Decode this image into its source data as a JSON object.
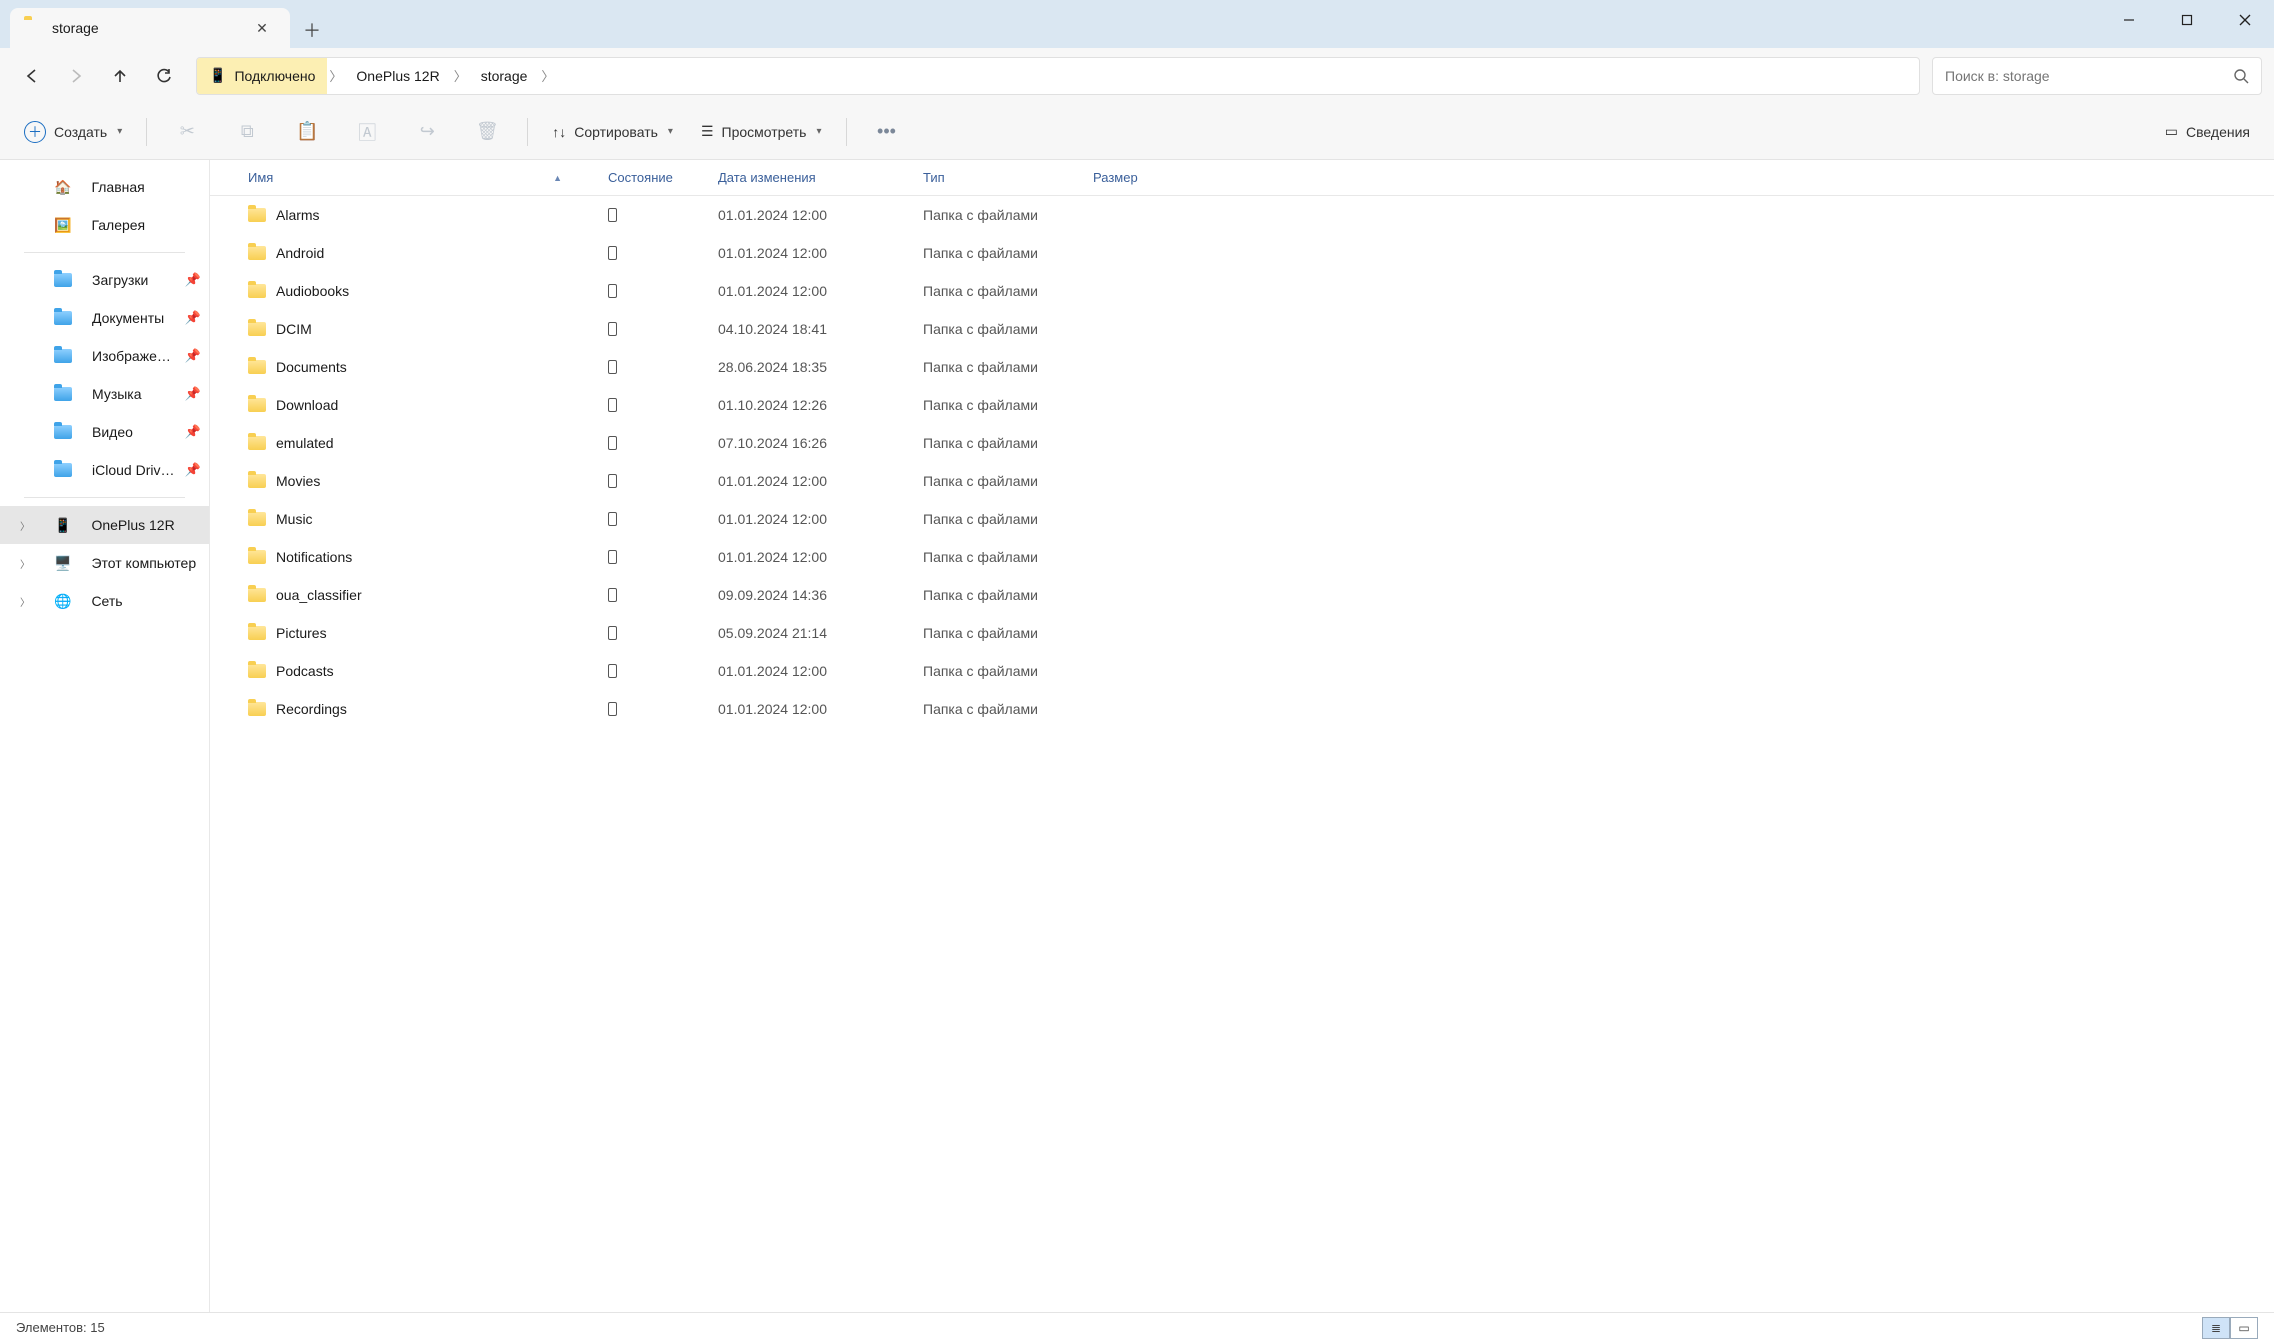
{
  "tab": {
    "title": "storage"
  },
  "breadcrumbs": {
    "connected_label": "Подключено",
    "items": [
      "OnePlus 12R",
      "storage"
    ]
  },
  "search": {
    "placeholder": "Поиск в: storage"
  },
  "toolbar": {
    "create": "Создать",
    "sort": "Сортировать",
    "view": "Просмотреть",
    "details": "Сведения"
  },
  "columns": {
    "name": "Имя",
    "state": "Состояние",
    "date": "Дата изменения",
    "type": "Тип",
    "size": "Размер"
  },
  "sidebar": {
    "quick": [
      {
        "label": "Главная",
        "icon": "home"
      },
      {
        "label": "Галерея",
        "icon": "gallery"
      }
    ],
    "pinned": [
      {
        "label": "Загрузки"
      },
      {
        "label": "Документы"
      },
      {
        "label": "Изображения"
      },
      {
        "label": "Музыка"
      },
      {
        "label": "Видео"
      },
      {
        "label": "iCloud Drive (Ma"
      }
    ],
    "tree": [
      {
        "label": "OnePlus 12R",
        "selected": true,
        "icon": "phone"
      },
      {
        "label": "Этот компьютер",
        "icon": "pc"
      },
      {
        "label": "Сеть",
        "icon": "net"
      }
    ]
  },
  "rows": [
    {
      "name": "Alarms",
      "date": "01.01.2024 12:00",
      "type": "Папка с файлами"
    },
    {
      "name": "Android",
      "date": "01.01.2024 12:00",
      "type": "Папка с файлами"
    },
    {
      "name": "Audiobooks",
      "date": "01.01.2024 12:00",
      "type": "Папка с файлами"
    },
    {
      "name": "DCIM",
      "date": "04.10.2024 18:41",
      "type": "Папка с файлами"
    },
    {
      "name": "Documents",
      "date": "28.06.2024 18:35",
      "type": "Папка с файлами"
    },
    {
      "name": "Download",
      "date": "01.10.2024 12:26",
      "type": "Папка с файлами"
    },
    {
      "name": "emulated",
      "date": "07.10.2024 16:26",
      "type": "Папка с файлами"
    },
    {
      "name": "Movies",
      "date": "01.01.2024 12:00",
      "type": "Папка с файлами"
    },
    {
      "name": "Music",
      "date": "01.01.2024 12:00",
      "type": "Папка с файлами"
    },
    {
      "name": "Notifications",
      "date": "01.01.2024 12:00",
      "type": "Папка с файлами"
    },
    {
      "name": "oua_classifier",
      "date": "09.09.2024 14:36",
      "type": "Папка с файлами"
    },
    {
      "name": "Pictures",
      "date": "05.09.2024 21:14",
      "type": "Папка с файлами"
    },
    {
      "name": "Podcasts",
      "date": "01.01.2024 12:00",
      "type": "Папка с файлами"
    },
    {
      "name": "Recordings",
      "date": "01.01.2024 12:00",
      "type": "Папка с файлами"
    }
  ],
  "status": {
    "count_label": "Элементов: 15"
  }
}
